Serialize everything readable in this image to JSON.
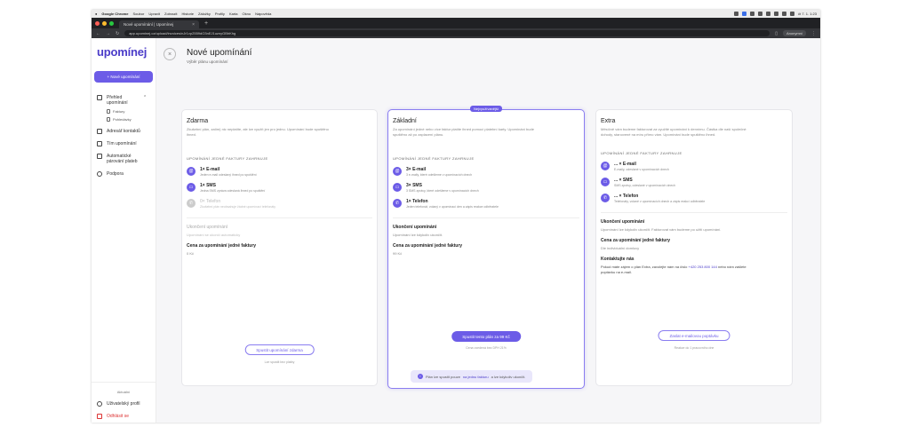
{
  "menubar": {
    "app": "Google Chrome",
    "items": [
      "Soubor",
      "Upravit",
      "Zobrazit",
      "Historie",
      "Záložky",
      "Profily",
      "Karta",
      "Okno",
      "Nápověda"
    ],
    "clock": "čt 7. 1. 1:23"
  },
  "browser": {
    "tab_title": "Nové upomínání | Upomínej",
    "url": "app.upominej.cz/upload/invoices/nJr1vp2559dO3nEJ1uznyGBhKhg",
    "profile": "Anonymní"
  },
  "sidebar": {
    "logo": "upomínej",
    "new_button": "+ Nové upomínání",
    "nav": {
      "prehled": "Přehled upomínání",
      "faktury": "Faktury",
      "pohledavky": "Pohledávky",
      "adresar": "Adresář kontaktů",
      "tim": "Tím upomínání",
      "parovani": "Automatické párování plateb",
      "podpora": "Podpora"
    },
    "version": "Aktuální",
    "profile": "Uživatelský profil",
    "logout": "Odhlásit se"
  },
  "page": {
    "title": "Nové upomínání",
    "subtitle": "Výběr plánu upomínání"
  },
  "plans": {
    "zdarma": {
      "name": "Zdarma",
      "desc": "Zkušební plán, zatím) nic neplatíte, ale lze využít jen pro jednu. Upomínání bude spuštěno ihned.",
      "section": "UPOMÍNÁNÍ JEDNÉ FAKTURY ZAHRNUJE",
      "f1_title": "1× E-mail",
      "f1_desc": "Jeden e-mail odeslaný ihned po spuštění",
      "f2_title": "1× SMS",
      "f2_desc": "Jedna SMS zpráva odeslaná ihned po spuštění",
      "f3_title": "0× Telefon",
      "f3_desc": "Zkušební plán neobsahuje žádné upomínací telefonáty",
      "ukonceni_label": "Ukončení upomínání",
      "ukonceni_value": "Upomínání se ukončí automaticky",
      "cena_label": "Cena za upomínání jedné faktury",
      "cena_value": "0 Kč",
      "button": "Spustit upomínání zdarma",
      "fine": "Lze spustit bez platby"
    },
    "zakladni": {
      "badge": "Nejvyužívanější",
      "name": "Základní",
      "desc": "Za upomínání jedné nebo více faktur platíte ihned pomocí platební karty. Upomínání bude spuštěno až po zaplacení plánu.",
      "section": "UPOMÍNÁNÍ JEDNÉ FAKTURY ZAHRNUJE",
      "f1_title": "3× E-mail",
      "f1_desc": "3 e-maily, které odešleme v upomínacích dnech",
      "f2_title": "3× SMS",
      "f2_desc": "3 SMS zprávy, které odešleme v upomínacích dnech",
      "f3_title": "1× Telefon",
      "f3_desc": "Jeden telefonát, volaný v upomínací den a zápis reakce odběratele",
      "ukonceni_label": "Ukončení upomínání",
      "ukonceni_value": "Upomínání lze kdykoliv ukončit.",
      "cena_label": "Cena za upomínání jedné faktury",
      "cena_value": "99 Kč",
      "button": "Spustit tento plán za 99 Kč",
      "fine": "Cena uvedená bez DPH 21%"
    },
    "extra": {
      "name": "Extra",
      "desc": "Měsíčně vám budeme fakturovat za využité upomínání k dennímu. Částka dle naší společné dohody, stanovené na míru přímo vám. Upomínání bude spuštěno ihned.",
      "section": "UPOMÍNÁNÍ JEDNÉ FAKTURY ZAHRNUJE",
      "f1_title": "... × E-mail",
      "f1_desc": "E-maily, odeslané v upomínacích dnech",
      "f2_title": "... × SMS",
      "f2_desc": "SMS zprávy, odeslané v upomínacích dnech",
      "f3_title": "... × Telefon",
      "f3_desc": "Telefonáty, volané v upomínacích dnech a zápis reakcí odběratele",
      "ukonceni_label": "Ukončení upomínání",
      "ukonceni_value": "Upomínání lze kdykoliv ukončit. Fakturovat vám budeme po užití upomínání.",
      "cena_label": "Cena za upomínání jedné faktury",
      "cena_value": "Dle individuální domluvy",
      "kontakt_label": "Kontaktujte nás",
      "kontakt_pre": "Pokud máte zájem o plán Extra, zavolejte nám na číslo",
      "kontakt_phone": "+420 253 800 144",
      "kontakt_post": "nebo nám zašlete poptávku na e-mail.",
      "button": "Zaslat e-mailovou poptávku",
      "fine": "Reakce do 1 pracovního dne"
    }
  },
  "info": {
    "pre": "Plán lze spustit pouze",
    "link": "na jednu fakturu",
    "post": "a lze kdykoliv ukončit."
  },
  "colors": {
    "accent": "#6c5ce7",
    "logo": "#4b3cc9"
  }
}
